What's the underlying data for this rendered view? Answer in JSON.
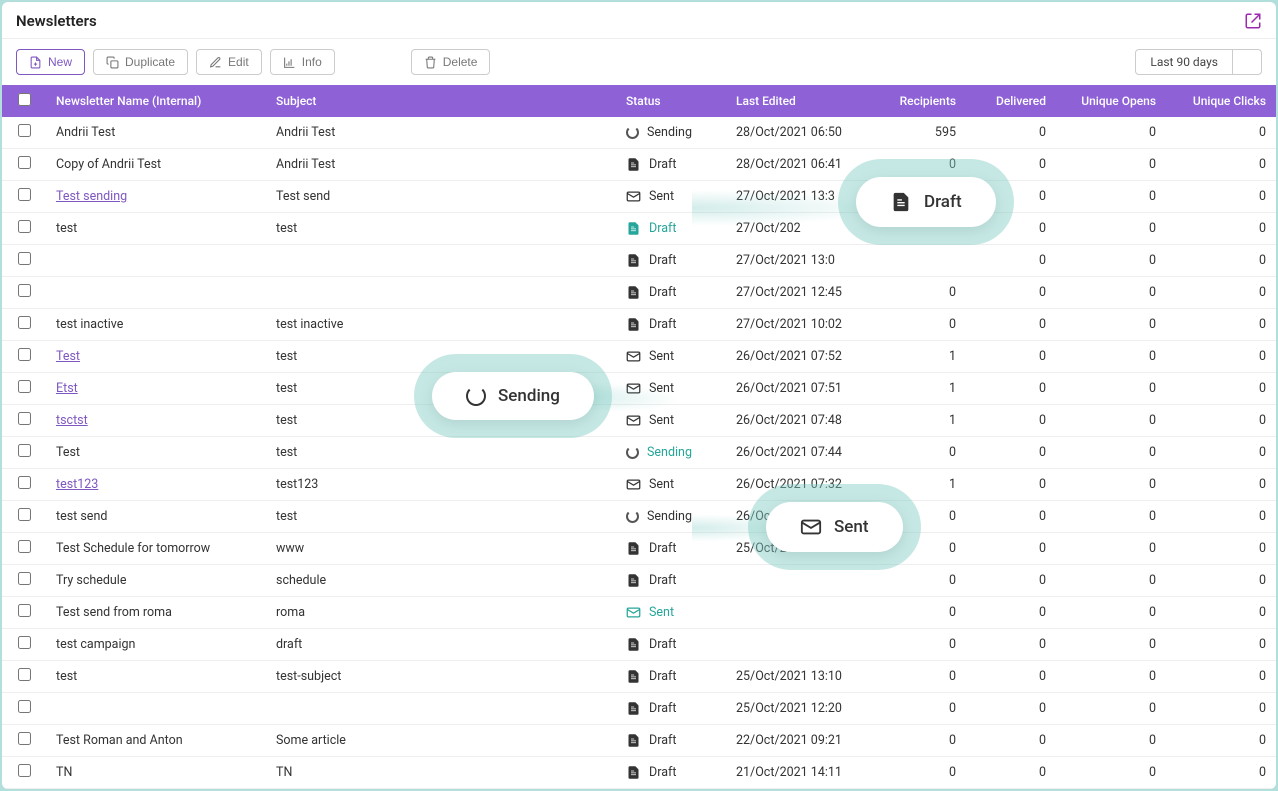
{
  "title": "Newsletters",
  "toolbar": {
    "new": "New",
    "duplicate": "Duplicate",
    "edit": "Edit",
    "info": "Info",
    "delete": "Delete"
  },
  "date_filter": {
    "label": "Last 90 days"
  },
  "columns": {
    "name": "Newsletter Name (Internal)",
    "subject": "Subject",
    "status": "Status",
    "last_edited": "Last Edited",
    "recipients": "Recipients",
    "delivered": "Delivered",
    "opens": "Unique Opens",
    "clicks": "Unique Clicks"
  },
  "callouts": {
    "draft": "Draft",
    "sending": "Sending",
    "sent": "Sent"
  },
  "status_labels": {
    "Sending": "Sending",
    "Draft": "Draft",
    "Sent": "Sent"
  },
  "rows": [
    {
      "name": "Andrii Test",
      "link": false,
      "subject": "Andrii Test",
      "status": "Sending",
      "edited": "28/Oct/2021 06:50",
      "recipients": "595",
      "delivered": "0",
      "opens": "0",
      "clicks": "0"
    },
    {
      "name": "Copy of Andrii Test",
      "link": false,
      "subject": "Andrii Test",
      "status": "Draft",
      "edited": "28/Oct/2021 06:41",
      "recipients": "0",
      "delivered": "0",
      "opens": "0",
      "clicks": "0"
    },
    {
      "name": "Test sending",
      "link": true,
      "subject": "Test send",
      "status": "Sent",
      "edited": "27/Oct/2021 13:3",
      "recipients": "",
      "delivered": "0",
      "opens": "0",
      "clicks": "0"
    },
    {
      "name": "test",
      "link": false,
      "subject": "test",
      "status": "Draft",
      "edited": "27/Oct/202",
      "recipients": "",
      "delivered": "0",
      "opens": "0",
      "clicks": "0",
      "hl": true
    },
    {
      "name": "",
      "link": false,
      "subject": "",
      "status": "Draft",
      "edited": "27/Oct/2021 13:0",
      "recipients": "",
      "delivered": "0",
      "opens": "0",
      "clicks": "0"
    },
    {
      "name": "",
      "link": false,
      "subject": "",
      "status": "Draft",
      "edited": "27/Oct/2021 12:45",
      "recipients": "0",
      "delivered": "0",
      "opens": "0",
      "clicks": "0"
    },
    {
      "name": "test inactive",
      "link": false,
      "subject": "test inactive",
      "status": "Draft",
      "edited": "27/Oct/2021 10:02",
      "recipients": "0",
      "delivered": "0",
      "opens": "0",
      "clicks": "0"
    },
    {
      "name": "Test",
      "link": true,
      "subject": "test",
      "status": "Sent",
      "edited": "26/Oct/2021 07:52",
      "recipients": "1",
      "delivered": "0",
      "opens": "0",
      "clicks": "0"
    },
    {
      "name": "Etst",
      "link": true,
      "subject": "test",
      "status": "Sent",
      "edited": "26/Oct/2021 07:51",
      "recipients": "1",
      "delivered": "0",
      "opens": "0",
      "clicks": "0"
    },
    {
      "name": "tsctst",
      "link": true,
      "subject": "test",
      "status": "Sent",
      "edited": "26/Oct/2021 07:48",
      "recipients": "1",
      "delivered": "0",
      "opens": "0",
      "clicks": "0"
    },
    {
      "name": "Test",
      "link": false,
      "subject": "test",
      "status": "Sending",
      "edited": "26/Oct/2021 07:44",
      "recipients": "0",
      "delivered": "0",
      "opens": "0",
      "clicks": "0",
      "hl": true
    },
    {
      "name": "test123",
      "link": true,
      "subject": "test123",
      "status": "Sent",
      "edited": "26/Oct/2021 07:32",
      "recipients": "1",
      "delivered": "0",
      "opens": "0",
      "clicks": "0"
    },
    {
      "name": "test send",
      "link": false,
      "subject": "test",
      "status": "Sending",
      "edited": "26/Oct/2021 07:26",
      "recipients": "0",
      "delivered": "0",
      "opens": "0",
      "clicks": "0"
    },
    {
      "name": "Test Schedule for tomorrow",
      "link": false,
      "subject": "www",
      "status": "Draft",
      "edited": "25/Oct/2021 13:49",
      "recipients": "0",
      "delivered": "0",
      "opens": "0",
      "clicks": "0"
    },
    {
      "name": "Try schedule",
      "link": false,
      "subject": "schedule",
      "status": "Draft",
      "edited": "",
      "recipients": "0",
      "delivered": "0",
      "opens": "0",
      "clicks": "0"
    },
    {
      "name": "Test send from roma",
      "link": false,
      "subject": "roma",
      "status": "Sent",
      "edited": "",
      "recipients": "0",
      "delivered": "0",
      "opens": "0",
      "clicks": "0",
      "hl": true
    },
    {
      "name": "test campaign",
      "link": false,
      "subject": "draft",
      "status": "Draft",
      "edited": "",
      "recipients": "0",
      "delivered": "0",
      "opens": "0",
      "clicks": "0"
    },
    {
      "name": "test",
      "link": false,
      "subject": "test-subject",
      "status": "Draft",
      "edited": "25/Oct/2021 13:10",
      "recipients": "0",
      "delivered": "0",
      "opens": "0",
      "clicks": "0"
    },
    {
      "name": "",
      "link": false,
      "subject": "",
      "status": "Draft",
      "edited": "25/Oct/2021 12:20",
      "recipients": "0",
      "delivered": "0",
      "opens": "0",
      "clicks": "0"
    },
    {
      "name": "Test Roman and Anton",
      "link": false,
      "subject": "Some article",
      "status": "Draft",
      "edited": "22/Oct/2021 09:21",
      "recipients": "0",
      "delivered": "0",
      "opens": "0",
      "clicks": "0"
    },
    {
      "name": "TN",
      "link": false,
      "subject": "TN",
      "status": "Draft",
      "edited": "21/Oct/2021 14:11",
      "recipients": "0",
      "delivered": "0",
      "opens": "0",
      "clicks": "0"
    }
  ]
}
